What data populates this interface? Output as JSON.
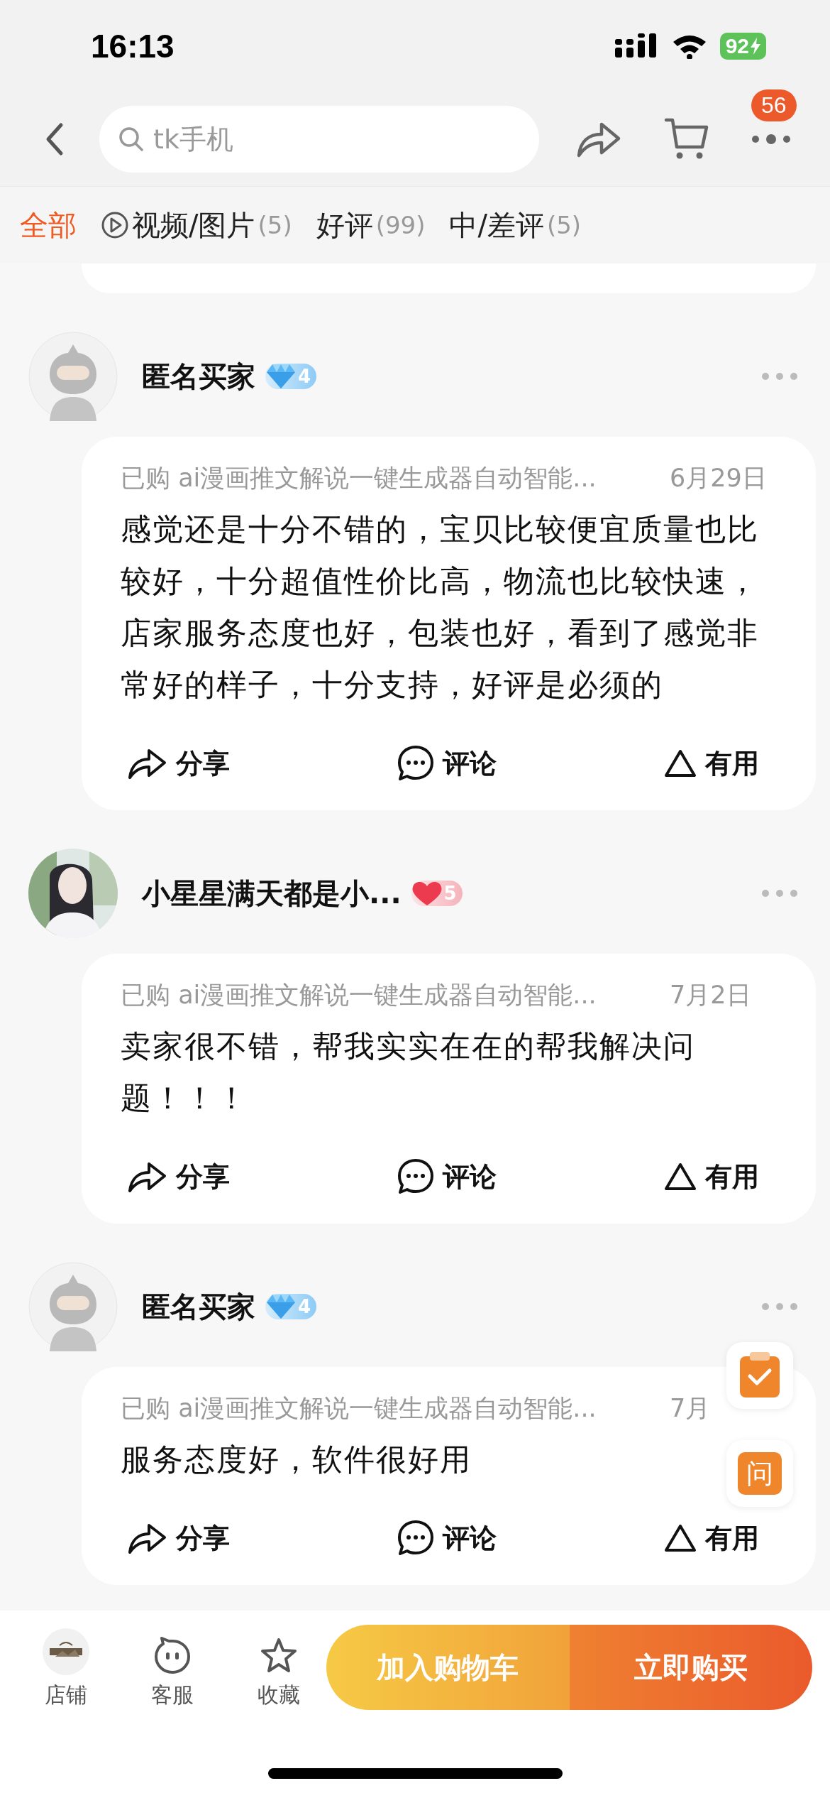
{
  "status_bar": {
    "time": "16:13",
    "battery": "92"
  },
  "nav": {
    "search_placeholder": "tk手机",
    "badge": "56"
  },
  "tabs": [
    {
      "label": "全部",
      "kind": "plain",
      "selected": true
    },
    {
      "label": "视频/图片",
      "count": "(5)",
      "kind": "video",
      "selected": false
    },
    {
      "label": "好评",
      "count": "(99)",
      "kind": "plain",
      "selected": false
    },
    {
      "label": "中/差评",
      "count": "(5)",
      "kind": "plain",
      "selected": false
    }
  ],
  "reviews": [
    {
      "user": "匿名买家",
      "avatar": {
        "kind": "anonymous"
      },
      "badge": {
        "kind": "diamond",
        "level": "4"
      },
      "purchased": "已购 ai漫画推文解说一键生成器自动智能...",
      "date": "6月29日",
      "text": "感觉还是十分不错的，宝贝比较便宜质量也比较好，十分超值性价比高，物流也比较快速，店家服务态度也好，包装也好，看到了感觉非常好的样子，十分支持，好评是必须的",
      "actions": [
        {
          "kind": "share",
          "label": "分享"
        },
        {
          "kind": "comment",
          "label": "评论"
        },
        {
          "kind": "useful",
          "label": "有用"
        }
      ]
    },
    {
      "user": "小星星满天都是小...",
      "avatar": {
        "kind": "picture"
      },
      "badge": {
        "kind": "heart",
        "level": "5"
      },
      "purchased": "已购 ai漫画推文解说一键生成器自动智能...",
      "date": "7月2日",
      "text": "卖家很不错，帮我实实在在的帮我解决问题！！！",
      "actions": [
        {
          "kind": "share",
          "label": "分享"
        },
        {
          "kind": "comment",
          "label": "评论"
        },
        {
          "kind": "useful",
          "label": "有用"
        }
      ]
    },
    {
      "user": "匿名买家",
      "avatar": {
        "kind": "anonymous"
      },
      "badge": {
        "kind": "diamond",
        "level": "4"
      },
      "purchased": "已购 ai漫画推文解说一键生成器自动智能...",
      "date": "7月",
      "text": "服务态度好，软件很好用",
      "actions": [
        {
          "kind": "share",
          "label": "分享"
        },
        {
          "kind": "comment",
          "label": "评论"
        },
        {
          "kind": "useful",
          "label": "有用"
        }
      ]
    }
  ],
  "floating": [
    {
      "kind": "checklist"
    },
    {
      "kind": "ask",
      "label": "问"
    }
  ],
  "bottom_bar": {
    "items": [
      {
        "kind": "store",
        "label": "店铺"
      },
      {
        "kind": "service",
        "label": "客服"
      },
      {
        "kind": "favorite",
        "label": "收藏"
      }
    ],
    "buttons": [
      {
        "kind": "cart",
        "label": "加入购物车"
      },
      {
        "kind": "buy",
        "label": "立即购买"
      }
    ]
  }
}
